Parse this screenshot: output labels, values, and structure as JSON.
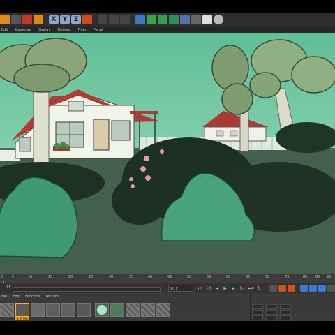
{
  "toolbar": {
    "axis_buttons": [
      "X",
      "Y",
      "Z"
    ]
  },
  "menu": {
    "items": [
      "Edit",
      "Cameras",
      "Display",
      "Options",
      "Filter",
      "Panel"
    ]
  },
  "timeline": {
    "ticks": [
      "0",
      "5",
      "10",
      "15",
      "20",
      "25",
      "30",
      "35",
      "40",
      "45",
      "50",
      "55",
      "60",
      "65",
      "70",
      "75",
      "80",
      "85",
      "90"
    ]
  },
  "transport": {
    "current_frame": "0 F",
    "end_frame": "90 F"
  },
  "materials": {
    "tabs": [
      "File",
      "Edit",
      "Function",
      "Texture"
    ],
    "items": [
      "",
      "1_F_MO",
      "",
      "",
      "",
      "",
      "",
      "",
      "",
      "",
      ""
    ],
    "selected_index": 1
  },
  "colors": {
    "sky": "#7fc9a8",
    "grass": "#3f5a48",
    "bush_light": "#3f9a72",
    "bush_dark": "#1f3526",
    "timeline_accent": "#ff8c00"
  }
}
